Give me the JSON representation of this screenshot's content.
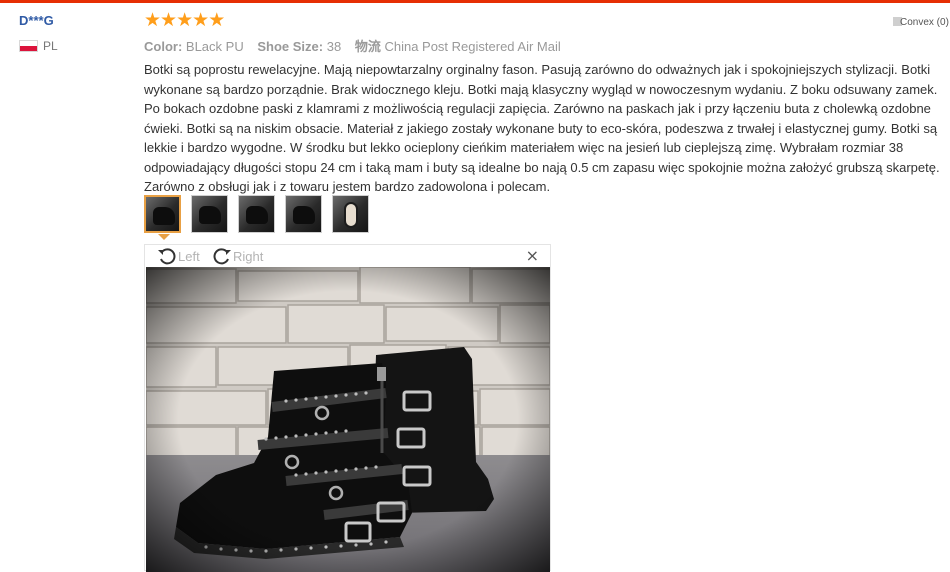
{
  "review": {
    "user": {
      "name": "D***G",
      "country": "PL"
    },
    "rating": {
      "stars": 5,
      "max": 5,
      "star_glyph": "★",
      "color": "#ff9e1b"
    },
    "attributes": [
      {
        "key": "Color:",
        "value": "BLack PU"
      },
      {
        "key": "Shoe Size:",
        "value": "38"
      },
      {
        "key": "物流",
        "value": "China Post Registered Air Mail"
      }
    ],
    "helpful": {
      "label": "Convex (0)"
    },
    "text": "Botki są poprostu rewelacyjne. Mają niepowtarzalny orginalny fason. Pasują zarówno do odważnych jak i spokojniejszych stylizacji. Botki wykonane są bardzo porządnie. Brak widocznego kleju. Botki mają klasyczny wygląd w nowoczesnym wydaniu. Z boku odsuwany zamek. Po bokach ozdobne paski z klamrami z możliwością regulacji zapięcia. Zarówno na paskach jak i przy łączeniu buta z cholewką ozdobne ćwieki. Botki są na niskim obsacie. Materiał z jakiego zostały wykonane buty to eco-skóra, podeszwa z trwałej i elastycznej gumy. Botki są lekkie i bardzo wygodne. W środku but lekko ocieplony cieńkim materiałem więc na jesień lub cieplejszą zimę. Wybrałam rozmiar 38 odpowiadający długości stopu 24 cm i taką mam i buty są idealne bo nają 0.5 cm zapasu więc spokojnie można założyć grubszą skarpetę. Zarówno z obsługi jak i z towaru jestem bardzo zadowolona i polecam.",
    "thumbnails": [
      {
        "icon": "boot-photo",
        "active": true
      },
      {
        "icon": "boot-photo",
        "active": false
      },
      {
        "icon": "boot-photo",
        "active": false
      },
      {
        "icon": "boot-photo",
        "active": false
      },
      {
        "icon": "sole-photo",
        "active": false
      }
    ],
    "viewer": {
      "rotate_left_label": "Left",
      "rotate_right_label": "Right",
      "close_glyph": "×"
    }
  }
}
